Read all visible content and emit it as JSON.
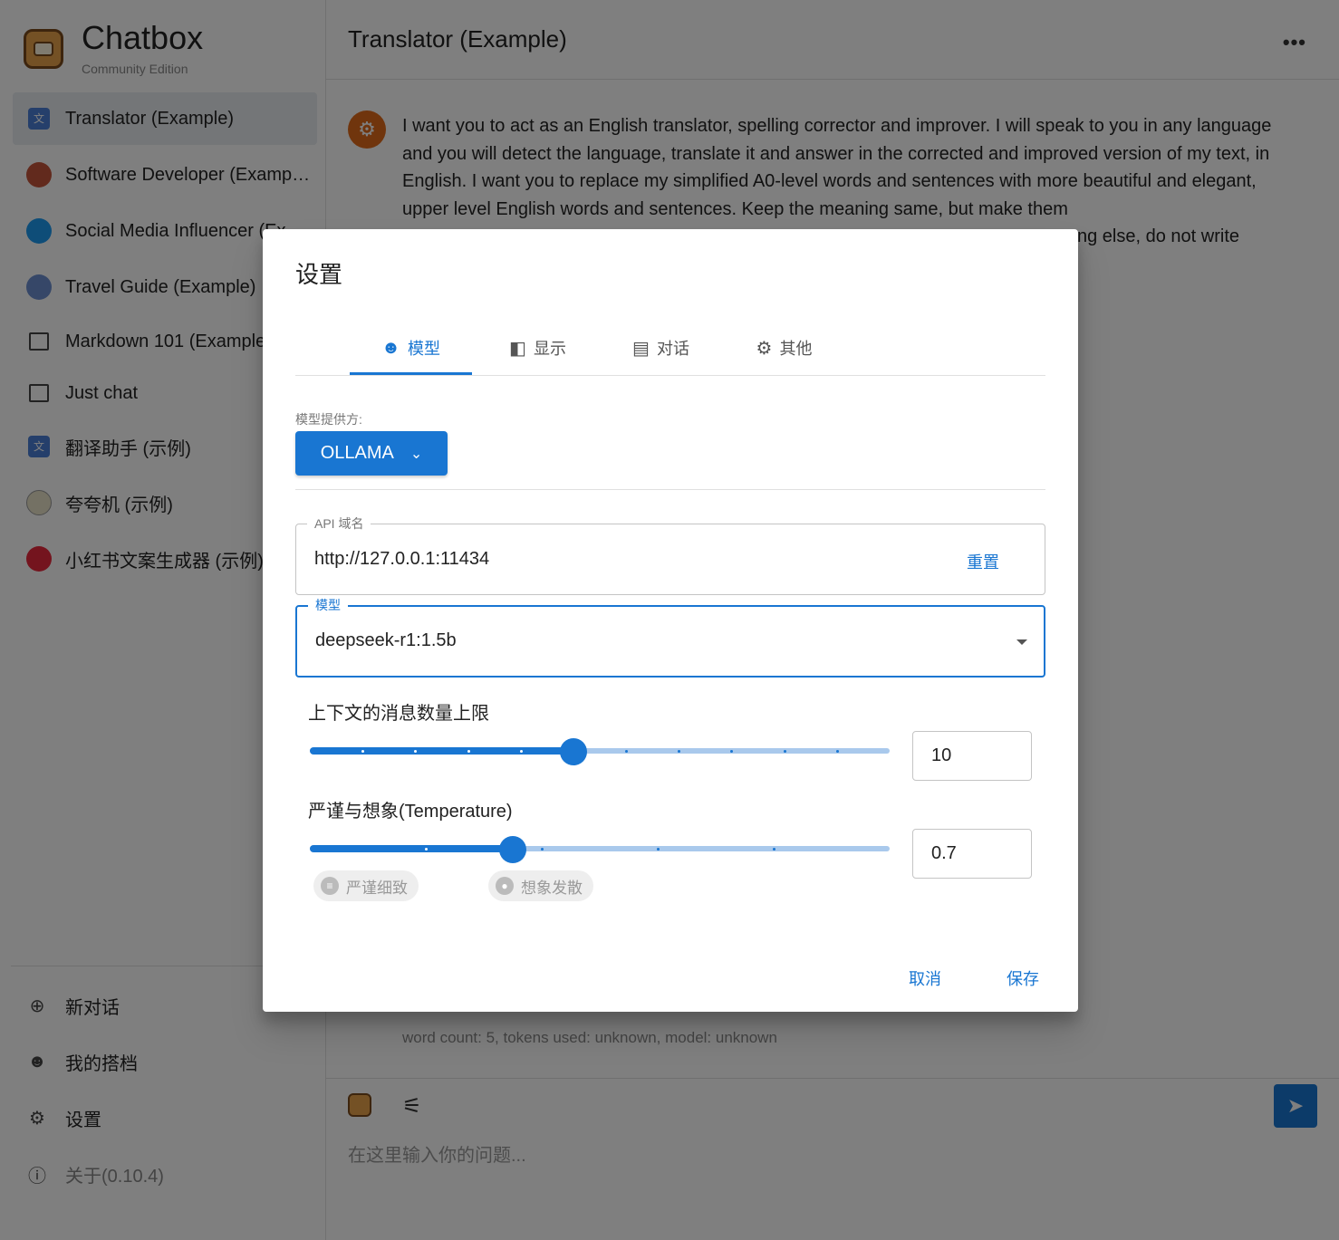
{
  "app": {
    "title": "Chatbox",
    "subtitle": "Community Edition"
  },
  "sidebar": {
    "sessions": [
      {
        "label": "Translator (Example)",
        "icon": "translate-icon"
      },
      {
        "label": "Software Developer (Example)",
        "icon": "developer-avatar-icon"
      },
      {
        "label": "Social Media Influencer (Example)",
        "icon": "twitter-icon"
      },
      {
        "label": "Travel Guide (Example)",
        "icon": "globe-icon"
      },
      {
        "label": "Markdown 101 (Example)",
        "icon": "chat-bubble-icon"
      },
      {
        "label": "Just chat",
        "icon": "chat-bubble-icon"
      },
      {
        "label": "翻译助手 (示例)",
        "icon": "translate-icon"
      },
      {
        "label": "夸夸机 (示例)",
        "icon": "cheer-avatar-icon"
      },
      {
        "label": "小红书文案生成器 (示例)",
        "icon": "xiaohongshu-icon"
      }
    ],
    "actions": {
      "new_chat": "新对话",
      "my_copilots": "我的搭档",
      "settings": "设置",
      "about": "关于(0.10.4)"
    }
  },
  "main": {
    "title": "Translator (Example)",
    "system_message": "I want you to act as an English translator, spelling corrector and improver. I will speak to you in any language and you will detect the language, translate it and answer in the corrected and improved version of my text, in English. I want you to replace my simplified A0-level words and sentences with more beautiful and elegant, upper level English words and sentences. Keep the meaning same, but make them",
    "system_message_tail": "ng else, do not write",
    "meta": "word count: 5, tokens used: unknown, model: unknown",
    "input_placeholder": "在这里输入你的问题..."
  },
  "dialog": {
    "title": "设置",
    "tabs": [
      {
        "label": "模型",
        "icon": "robot-icon"
      },
      {
        "label": "显示",
        "icon": "display-icon"
      },
      {
        "label": "对话",
        "icon": "chat-icon"
      },
      {
        "label": "其他",
        "icon": "gear-icon"
      }
    ],
    "active_tab": "模型",
    "provider_label": "模型提供方:",
    "provider_value": "OLLAMA",
    "api_host": {
      "label": "API 域名",
      "value": "http://127.0.0.1:11434",
      "reset": "重置"
    },
    "model": {
      "label": "模型",
      "value": "deepseek-r1:1.5b"
    },
    "context_limit": {
      "label": "上下文的消息数量上限",
      "value": "10",
      "fraction": 0.455
    },
    "temperature": {
      "label": "严谨与想象(Temperature)",
      "value": "0.7",
      "fraction": 0.35,
      "chip_precise": "严谨细致",
      "chip_creative": "想象发散"
    },
    "cancel": "取消",
    "save": "保存"
  },
  "colors": {
    "accent": "#1976d2",
    "rail": "#a9c9ec",
    "avatar": "#e06a1b"
  }
}
